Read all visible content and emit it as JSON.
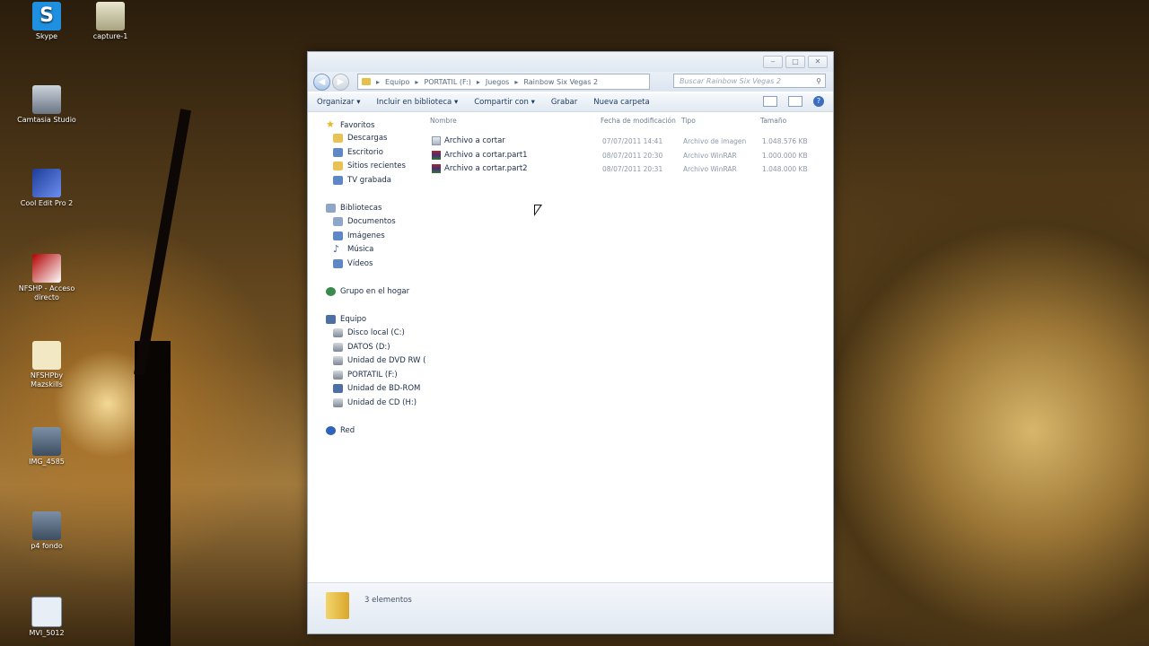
{
  "desktop": {
    "icons": [
      {
        "label": "Skype",
        "glyph": "S"
      },
      {
        "label": "capture-1"
      },
      {
        "label": "Camtasia Studio"
      },
      {
        "label": "Cool Edit Pro 2"
      },
      {
        "label": "NFSHP - Acceso directo"
      },
      {
        "label": "NFSHPby Mazskills"
      },
      {
        "label": "IMG_4585"
      },
      {
        "label": "p4 fondo"
      },
      {
        "label": "MVI_5012"
      }
    ]
  },
  "window": {
    "controls": {
      "minimize": "‒",
      "maximize": "□",
      "close": "✕"
    },
    "breadcrumb": [
      "Equipo",
      "PORTATIL (F:)",
      "Juegos",
      "Rainbow Six Vegas 2"
    ],
    "search_placeholder": "Buscar Rainbow Six Vegas 2",
    "toolbar": {
      "organize": "Organizar ▾",
      "include_library": "Incluir en biblioteca ▾",
      "share": "Compartir con ▾",
      "burn": "Grabar",
      "new_folder": "Nueva carpeta"
    },
    "nav": {
      "favorites": "Favoritos",
      "downloads": "Descargas",
      "desktop": "Escritorio",
      "recent": "Sitios recientes",
      "tv": "TV grabada",
      "libraries": "Bibliotecas",
      "documents": "Documentos",
      "images": "Imágenes",
      "music": "Música",
      "videos": "Vídeos",
      "homegroup": "Grupo en el hogar",
      "computer": "Equipo",
      "drive_c": "Disco local (C:)",
      "drive_d": "DATOS (D:)",
      "drive_dvd": "Unidad de DVD RW (",
      "drive_f": "PORTATIL (F:)",
      "drive_bd": "Unidad de BD-ROM",
      "drive_h": "Unidad de CD (H:)",
      "network": "Red"
    },
    "columns": {
      "name": "Nombre",
      "date": "Fecha de modificación",
      "type": "Tipo",
      "size": "Tamaño"
    },
    "files": [
      {
        "name": "Archivo a cortar",
        "date": "07/07/2011 14:41",
        "type": "Archivo de imagen",
        "size": "1.048.576 KB"
      },
      {
        "name": "Archivo a cortar.part1",
        "date": "08/07/2011 20:30",
        "type": "Archivo WinRAR",
        "size": "1.000.000 KB"
      },
      {
        "name": "Archivo a cortar.part2",
        "date": "08/07/2011 20:31",
        "type": "Archivo WinRAR",
        "size": "1.048.000 KB"
      }
    ],
    "status": "3 elementos"
  }
}
